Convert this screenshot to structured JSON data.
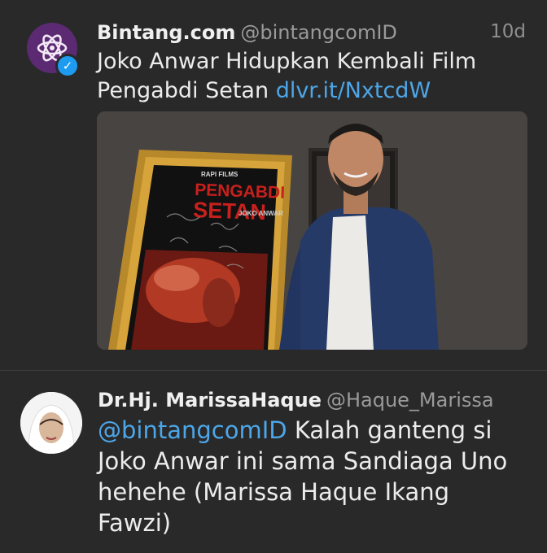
{
  "tweets": [
    {
      "name": "Bintang.com",
      "handle": "@bintangcomID",
      "time": "10d",
      "text": "Joko Anwar Hidupkan Kembali Film Pengabdi Setan",
      "link": "dlvr.it/NxtcdW",
      "media": {
        "poster_brand": "RAPI FILMS",
        "poster_title_1": "PENGABDI",
        "poster_title_2": "SETAN",
        "poster_credit": "JOKO ANWAR"
      }
    },
    {
      "name": "Dr.Hj. MarissaHaque",
      "handle": "@Haque_Marissa",
      "mention": "@bintangcomID",
      "text": " Kalah ganteng si Joko Anwar ini sama Sandiaga Uno hehehe (Marissa Haque Ikang Fawzi)"
    }
  ],
  "colors": {
    "background": "#292929",
    "link": "#4da6e8",
    "verified": "#1d9bf0"
  },
  "icons": {
    "verified": "verified-badge-icon",
    "bintang_logo": "atom-logo-icon"
  }
}
